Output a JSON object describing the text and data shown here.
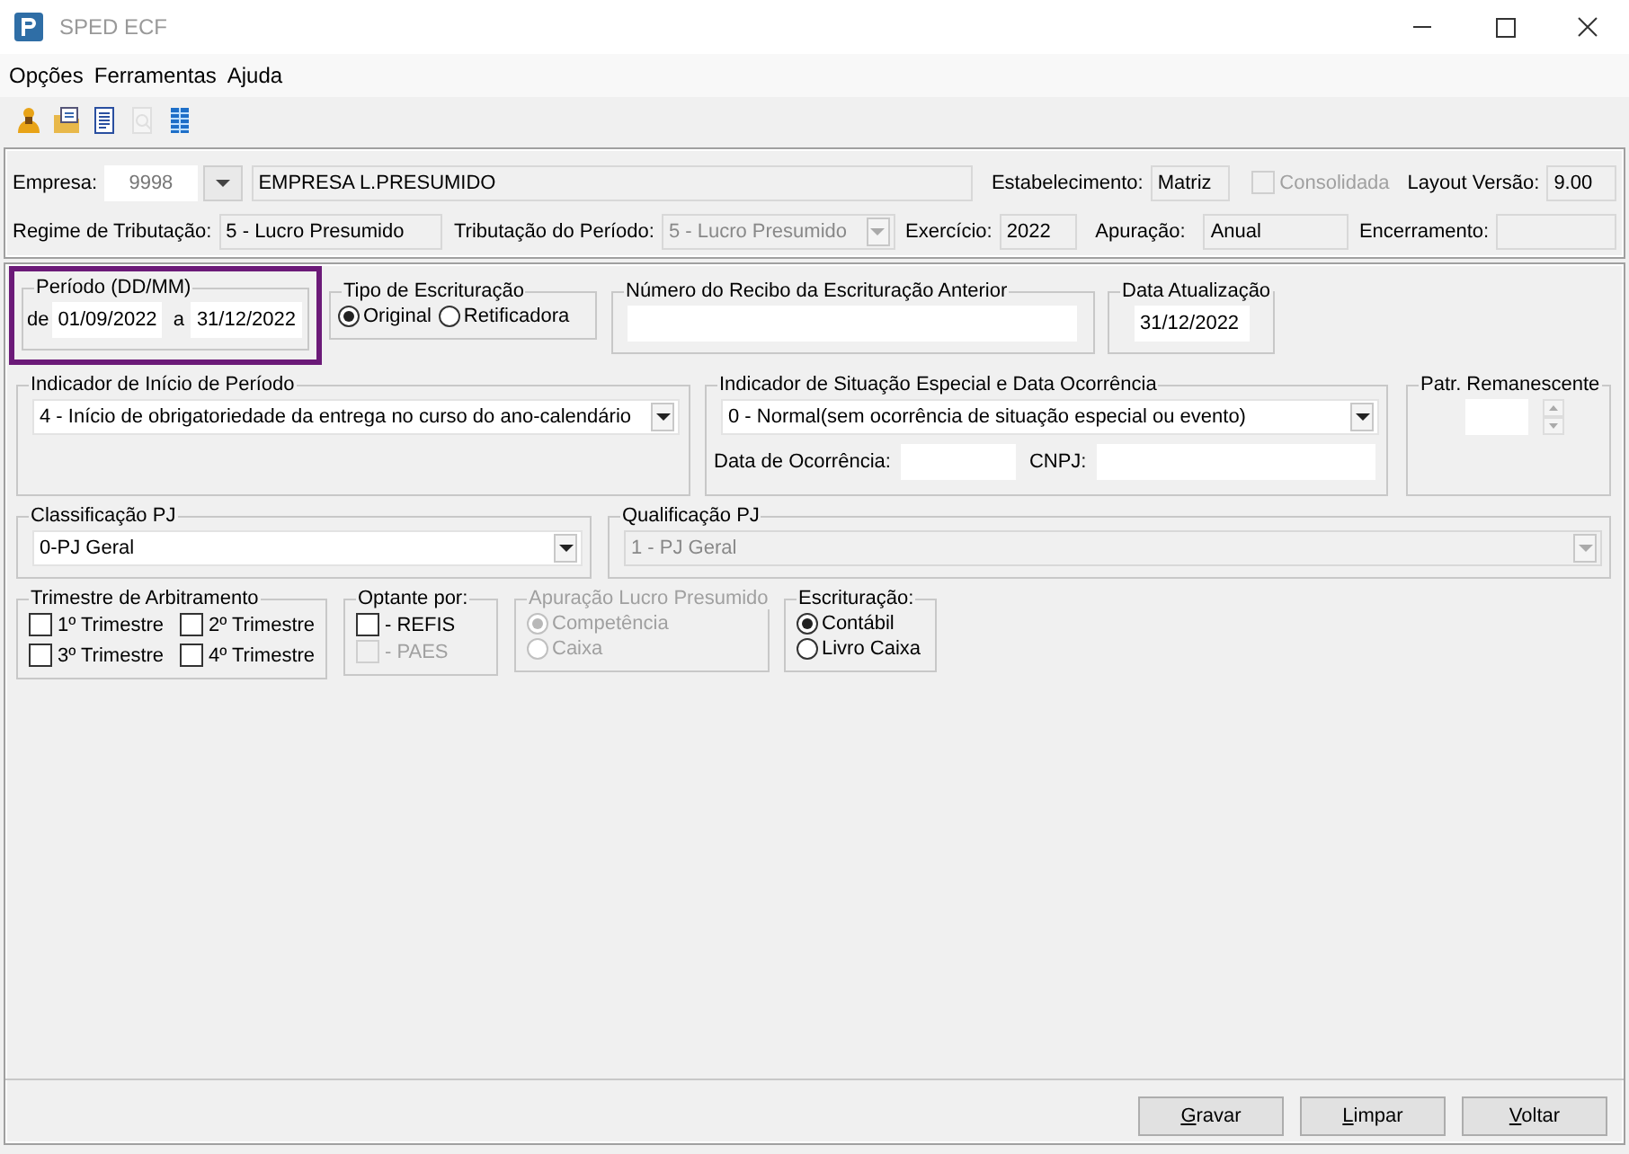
{
  "window": {
    "title": "SPED ECF"
  },
  "menu": [
    "Opções",
    "Ferramentas",
    "Ajuda"
  ],
  "toolbar": [
    {
      "disabled": false
    },
    {
      "disabled": false
    },
    {
      "disabled": false
    },
    {
      "disabled": true
    },
    {
      "disabled": false
    }
  ],
  "header": {
    "empresa": {
      "label": "Empresa:",
      "code": "9998",
      "name": "EMPRESA L.PRESUMIDO"
    },
    "estabelecimento": {
      "label": "Estabelecimento:",
      "value": "Matriz"
    },
    "consolidada": {
      "label": "Consolidada",
      "checked": false,
      "disabled": true
    },
    "layout": {
      "label": "Layout Versão:",
      "value": "9.00"
    },
    "regime": {
      "label": "Regime de Tributação:",
      "value": "5 - Lucro Presumido"
    },
    "tributacao": {
      "label": "Tributação do Período:",
      "value": "5 - Lucro Presumido",
      "disabled": true
    },
    "exercicio": {
      "label": "Exercício:",
      "value": "2022"
    },
    "apuracao": {
      "label": "Apuração:",
      "value": "Anual"
    },
    "encerramento": {
      "label": "Encerramento:"
    }
  },
  "periodo": {
    "legend": "Período (DD/MM)",
    "from_label": "de",
    "from": "01/09/2022",
    "to_label": "a",
    "to": "31/12/2022",
    "highlighted": true
  },
  "tipo": {
    "legend": "Tipo de Escrituração",
    "options": [
      {
        "label": "Original",
        "selected": true
      },
      {
        "label": "Retificadora",
        "selected": false
      }
    ]
  },
  "recibo": {
    "legend": "Número do Recibo da Escrituração Anterior"
  },
  "data_atualizacao": {
    "legend": "Data Atualização",
    "value": "31/12/2022"
  },
  "indicador_inicio": {
    "legend": "Indicador de Início de Período",
    "value": "4 - Início de obrigatoriedade da entrega no curso do ano-calendário"
  },
  "situacao": {
    "legend": "Indicador de Situação Especial e Data Ocorrência",
    "value": "0 - Normal(sem ocorrência de situação especial ou evento)",
    "ocorrencia_label": "Data de Ocorrência:",
    "cnpj_label": "CNPJ:"
  },
  "patr": {
    "legend": "Patr. Remanescente"
  },
  "classificacao": {
    "legend": "Classificação PJ",
    "value": "0-PJ Geral",
    "disabled": false
  },
  "qualificacao": {
    "legend": "Qualificação PJ",
    "value": "1 - PJ Geral",
    "disabled": true
  },
  "trimestre": {
    "legend": "Trimestre de Arbitramento",
    "items": [
      {
        "label": "1º Trimestre",
        "checked": false
      },
      {
        "label": "2º Trimestre",
        "checked": false
      },
      {
        "label": "3º Trimestre",
        "checked": false
      },
      {
        "label": "4º Trimestre",
        "checked": false
      }
    ]
  },
  "optante": {
    "legend": "Optante por:",
    "items": [
      {
        "label": "- REFIS",
        "checked": false,
        "disabled": false
      },
      {
        "label": "- PAES",
        "checked": false,
        "disabled": true
      }
    ]
  },
  "apuracao_lp": {
    "legend": "Apuração Lucro Presumido",
    "disabled": true,
    "options": [
      {
        "label": "Competência",
        "selected": true
      },
      {
        "label": "Caixa",
        "selected": false
      }
    ]
  },
  "escrituracao": {
    "legend": "Escrituração:",
    "options": [
      {
        "label": "Contábil",
        "selected": true
      },
      {
        "label": "Livro Caixa",
        "selected": false
      }
    ]
  },
  "buttons": [
    {
      "accel": "G",
      "rest": "ravar"
    },
    {
      "accel": "L",
      "rest": "impar"
    },
    {
      "accel": "V",
      "rest": "oltar"
    }
  ]
}
